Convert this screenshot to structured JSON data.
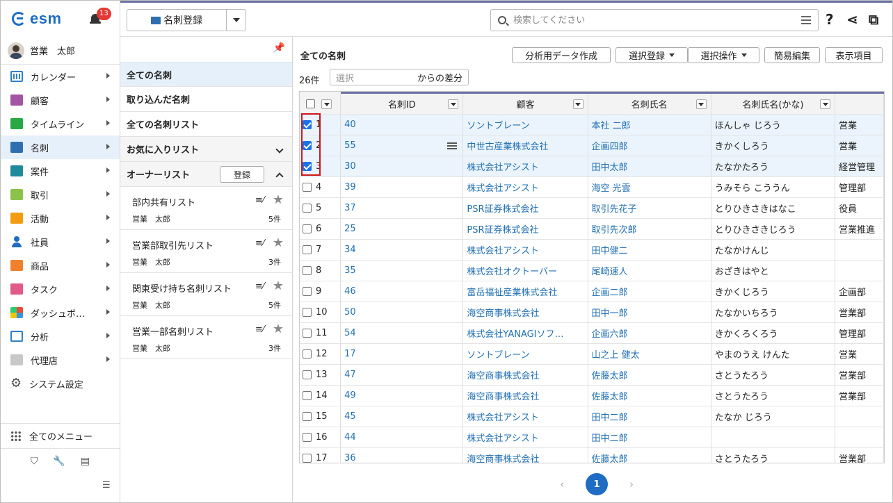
{
  "app": {
    "logo": "esm",
    "notification_count": "13"
  },
  "user": {
    "name": "営業　太郎"
  },
  "sidebar": {
    "items": [
      {
        "label": "カレンダー",
        "icon": "calendar-icon",
        "cls": "ic-cal",
        "active": false
      },
      {
        "label": "顧客",
        "icon": "customer-icon",
        "cls": "ic-cust",
        "active": false
      },
      {
        "label": "タイムライン",
        "icon": "timeline-icon",
        "cls": "ic-time",
        "active": false
      },
      {
        "label": "名刺",
        "icon": "business-card-icon",
        "cls": "ic-card",
        "active": true
      },
      {
        "label": "案件",
        "icon": "deal-icon",
        "cls": "ic-deal",
        "active": false
      },
      {
        "label": "取引",
        "icon": "trade-icon",
        "cls": "ic-trade",
        "active": false
      },
      {
        "label": "活動",
        "icon": "activity-icon",
        "cls": "ic-act",
        "active": false
      },
      {
        "label": "社員",
        "icon": "employee-icon",
        "cls": "ic-emp",
        "active": false
      },
      {
        "label": "商品",
        "icon": "product-icon",
        "cls": "ic-prod",
        "active": false
      },
      {
        "label": "タスク",
        "icon": "task-icon",
        "cls": "ic-task",
        "active": false
      },
      {
        "label": "ダッシュボ…",
        "icon": "dashboard-icon",
        "cls": "ic-dash",
        "active": false
      },
      {
        "label": "分析",
        "icon": "analysis-icon",
        "cls": "ic-ana",
        "active": false
      },
      {
        "label": "代理店",
        "icon": "agency-icon",
        "cls": "ic-agency",
        "active": false
      }
    ],
    "system_settings": "システム設定",
    "all_menu": "全てのメニュー"
  },
  "toolbar": {
    "register_label": "名刺登録",
    "search_placeholder": "検索してください",
    "help": "?"
  },
  "list_panel": {
    "items": [
      {
        "label": "全ての名刺",
        "selected": true
      },
      {
        "label": "取り込んだ名刺",
        "selected": false
      },
      {
        "label": "全ての名刺リスト",
        "selected": false
      }
    ],
    "favorites_label": "お気に入りリスト",
    "owner_label": "オーナーリスト",
    "owner_register": "登録",
    "owner_lists": [
      {
        "name": "部内共有リスト",
        "owner": "営業　太郎",
        "count": "5件"
      },
      {
        "name": "営業部取引先リスト",
        "owner": "営業　太郎",
        "count": "3件"
      },
      {
        "name": "関東受け持ち名刺リスト",
        "owner": "営業　太郎",
        "count": "5件"
      },
      {
        "name": "営業一部名刺リスト",
        "owner": "営業　太郎",
        "count": "3件"
      }
    ]
  },
  "main": {
    "title": "全ての名刺",
    "count": "26件",
    "diff_placeholder": "選択",
    "diff_suffix": "からの差分",
    "buttons": {
      "analysis": "分析用データ作成",
      "select_register": "選択登録",
      "select_operation": "選択操作",
      "quick_edit": "簡易編集",
      "display_items": "表示項目"
    },
    "columns": [
      "名刺ID",
      "顧客",
      "名刺氏名",
      "名刺氏名(かな)",
      ""
    ],
    "rows": [
      {
        "n": "1",
        "checked": true,
        "id": "40",
        "customer": "ソントブレーン",
        "name": "本社 二郎",
        "kana": "ほんしゃ じろう",
        "dept": "営業"
      },
      {
        "n": "2",
        "checked": true,
        "id": "55",
        "customer": "中世古産業株式会社",
        "name": "企画四郎",
        "kana": "きかくしろう",
        "dept": "営業"
      },
      {
        "n": "3",
        "checked": true,
        "id": "30",
        "customer": "株式会社アシスト",
        "name": "田中太郎",
        "kana": "たなかたろう",
        "dept": "経営管理"
      },
      {
        "n": "4",
        "checked": false,
        "id": "39",
        "customer": "株式会社アシスト",
        "name": "海空 光雲",
        "kana": "うみそら こううん",
        "dept": "管理部"
      },
      {
        "n": "5",
        "checked": false,
        "id": "37",
        "customer": "PSR証券株式会社",
        "name": "取引先花子",
        "kana": "とりひきさきはなこ",
        "dept": "役員"
      },
      {
        "n": "6",
        "checked": false,
        "id": "25",
        "customer": "PSR証券株式会社",
        "name": "取引先次郎",
        "kana": "とりひきさきじろう",
        "dept": "営業推進"
      },
      {
        "n": "7",
        "checked": false,
        "id": "34",
        "customer": "株式会社アシスト",
        "name": "田中健二",
        "kana": "たなかけんじ",
        "dept": ""
      },
      {
        "n": "8",
        "checked": false,
        "id": "35",
        "customer": "株式会社オクトーバー",
        "name": "尾崎速人",
        "kana": "おざきはやと",
        "dept": ""
      },
      {
        "n": "9",
        "checked": false,
        "id": "46",
        "customer": "富岳福祉産業株式会社",
        "name": "企画二郎",
        "kana": "きかくじろう",
        "dept": "企画部"
      },
      {
        "n": "10",
        "checked": false,
        "id": "50",
        "customer": "海空商事株式会社",
        "name": "田中一郎",
        "kana": "たなかいちろう",
        "dept": "営業部"
      },
      {
        "n": "11",
        "checked": false,
        "id": "54",
        "customer": "株式会社YANAGIソフ…",
        "name": "企画六郎",
        "kana": "きかくろくろう",
        "dept": "管理部"
      },
      {
        "n": "12",
        "checked": false,
        "id": "17",
        "customer": "ソントブレーン",
        "name": "山之上 健太",
        "kana": "やまのうえ けんた",
        "dept": "営業"
      },
      {
        "n": "13",
        "checked": false,
        "id": "47",
        "customer": "海空商事株式会社",
        "name": "佐藤太郎",
        "kana": "さとうたろう",
        "dept": "営業部"
      },
      {
        "n": "14",
        "checked": false,
        "id": "49",
        "customer": "海空商事株式会社",
        "name": "佐藤太郎",
        "kana": "さとうたろう",
        "dept": "営業部"
      },
      {
        "n": "15",
        "checked": false,
        "id": "45",
        "customer": "株式会社アシスト",
        "name": "田中二郎",
        "kana": "たなか じろう",
        "dept": ""
      },
      {
        "n": "16",
        "checked": false,
        "id": "44",
        "customer": "株式会社アシスト",
        "name": "田中二郎",
        "kana": "",
        "dept": ""
      },
      {
        "n": "17",
        "checked": false,
        "id": "36",
        "customer": "海空商事株式会社",
        "name": "佐藤太郎",
        "kana": "さとうたろう",
        "dept": "営業部"
      }
    ]
  },
  "pagination": {
    "current": "1",
    "prev": "‹",
    "next": "›"
  }
}
